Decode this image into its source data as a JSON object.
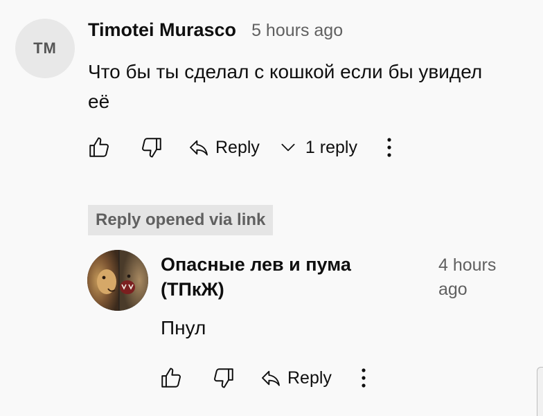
{
  "comment": {
    "avatar_initials": "TM",
    "author": "Timotei Murasco",
    "time": "5 hours ago",
    "text": "Что бы ты сделал с кошкой если бы увидел её",
    "reply_label": "Reply",
    "replies_toggle": "1 reply"
  },
  "notice": {
    "label": "Reply opened via link"
  },
  "reply": {
    "author": "Опасные лев и пума (ТПкЖ)",
    "time": "4 hours ago",
    "text": "Пнул",
    "reply_label": "Reply"
  },
  "icons": {
    "like": "thumbs-up-icon",
    "dislike": "thumbs-down-icon",
    "reply": "reply-arrow-icon",
    "expand": "chevron-down-icon",
    "more": "more-vertical-icon"
  },
  "colors": {
    "background": "#f9f9f9",
    "text": "#0f0f0f",
    "secondary_text": "#606060",
    "pill_background": "#e5e5e5",
    "avatar_background": "#e8e8e8"
  }
}
